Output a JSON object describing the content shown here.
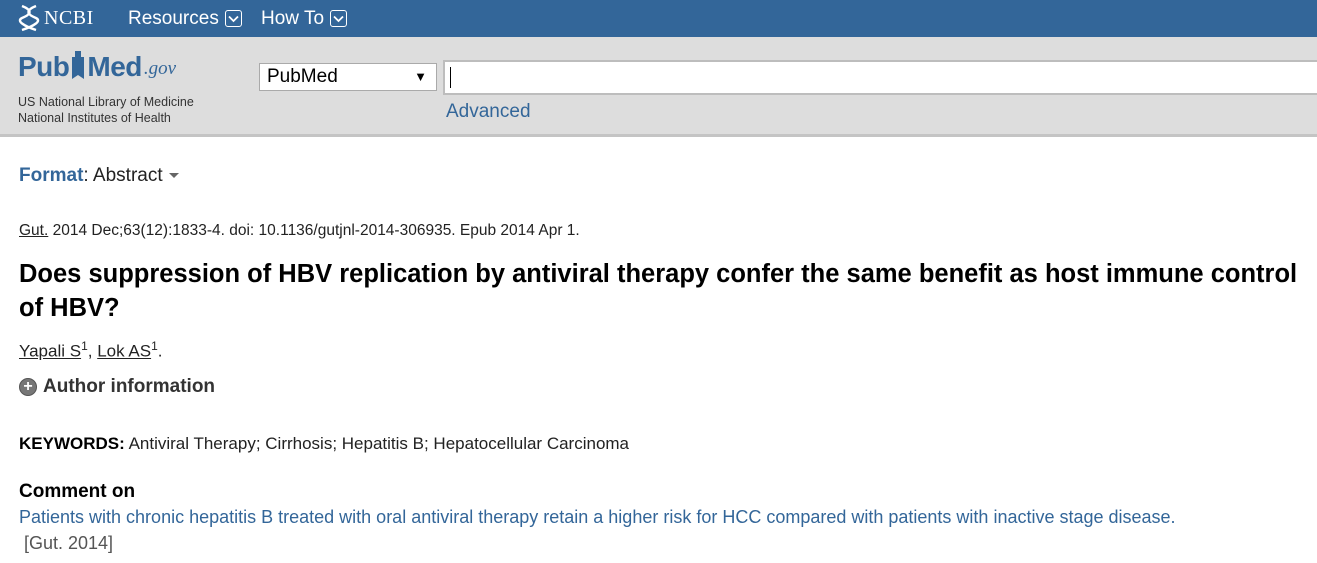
{
  "ncbi_bar": {
    "logo_text": "NCBI",
    "menus": [
      {
        "label": "Resources"
      },
      {
        "label": "How To"
      }
    ],
    "background": "#336699"
  },
  "pubmed_header": {
    "logo": {
      "pub": "Pub",
      "med": "Med",
      "gov": ".gov"
    },
    "org_line1": "US National Library of Medicine",
    "org_line2": "National Institutes of Health",
    "database_select": {
      "value": "PubMed"
    },
    "search": {
      "value": "",
      "placeholder": ""
    },
    "advanced_label": "Advanced"
  },
  "format": {
    "label": "Format",
    "value": "Abstract"
  },
  "article": {
    "journal": "Gut.",
    "citation_rest": " 2014 Dec;63(12):1833-4. doi: 10.1136/gutjnl-2014-306935. Epub 2014 Apr 1.",
    "title": "Does suppression of HBV replication by antiviral therapy confer the same benefit as host immune control of HBV?",
    "authors": [
      {
        "name": "Yapali S",
        "affil": "1"
      },
      {
        "name": "Lok AS",
        "affil": "1"
      }
    ],
    "author_info_label": "Author information",
    "keywords_label": "KEYWORDS:",
    "keywords": "Antiviral Therapy; Cirrhosis; Hepatitis B; Hepatocellular Carcinoma",
    "comment_heading": "Comment on",
    "comment_link": "Patients with chronic hepatitis B treated with oral antiviral therapy retain a higher risk for HCC compared with patients with inactive stage disease.",
    "comment_source": "[Gut. 2014]"
  },
  "colors": {
    "ncbi_blue": "#336699",
    "header_gray": "#dddddd",
    "link_blue": "#336699"
  }
}
